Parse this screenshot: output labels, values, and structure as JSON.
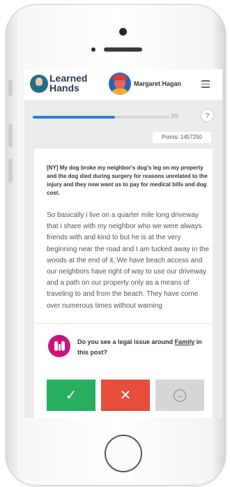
{
  "app": {
    "logo_text": "Learned Hands",
    "user_name": "Margaret Hagan"
  },
  "progress": {
    "label": "3/5",
    "fraction": 0.6,
    "help_label": "?"
  },
  "points": "Points: 1457250",
  "post": {
    "title": "[NY] My dog broke my neighbor's dog's leg on my property and the dog died during surgery for reasons unrelated to the injury and they now want us to pay for medical bills and dog cost.",
    "body": "So basically i live on a quarter mile long driveway that i share with my neighbor who we were always friends with and kind to but he is at the very beginning near the road and I am tucked away in the woods at the end of it.  We have beach access and our neighbors have right of way to use our driveway and a path on our property only as a means of traveling to and from the beach. They have come over numerous times without warning"
  },
  "question": {
    "prefix": "Do you see a legal issue around",
    "topic": "Family",
    "suffix": "in this post?"
  },
  "buttons": {
    "yes": "✓",
    "no": "✕",
    "skip": "→"
  },
  "colors": {
    "accent": "#2b7fd6",
    "yes": "#27ae60",
    "no": "#e74c3c",
    "skip": "#d6d6d6",
    "family_icon": "#c7157b"
  }
}
